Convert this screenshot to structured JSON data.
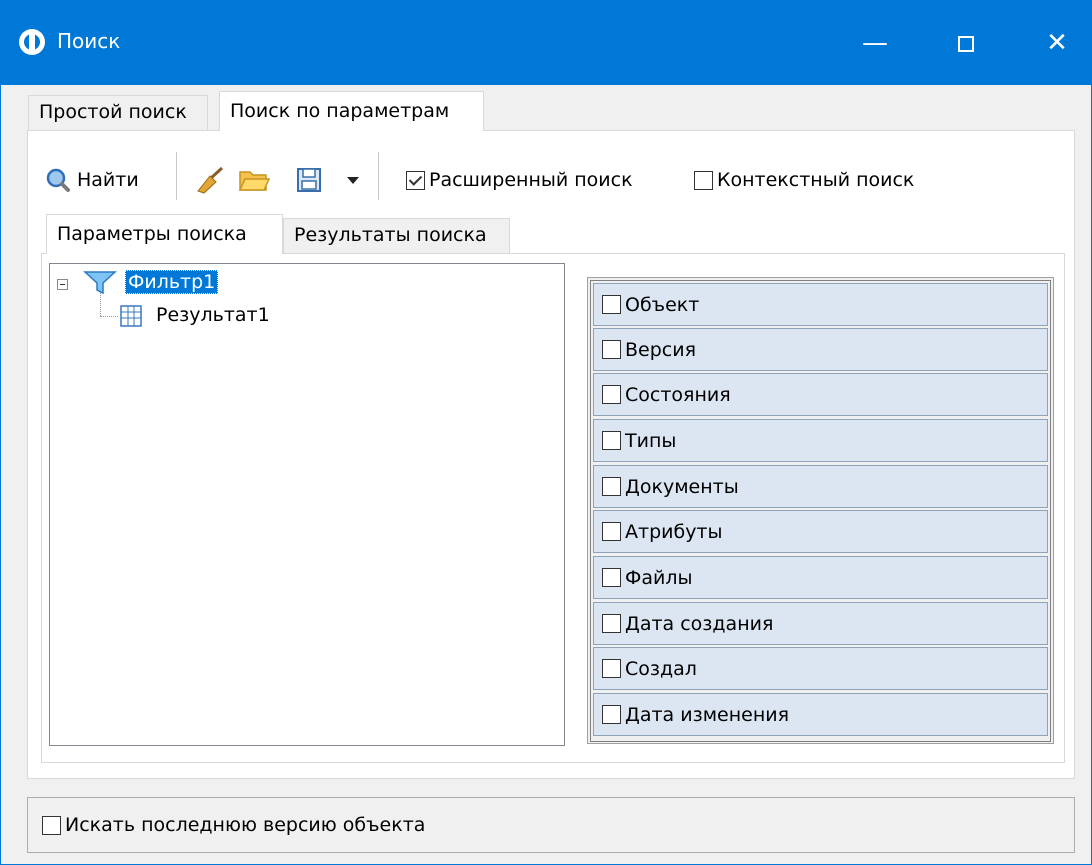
{
  "window": {
    "title": "Поиск",
    "minimize": "—",
    "close": "✕"
  },
  "tabs": [
    "Простой поиск",
    "Поиск по параметрам"
  ],
  "toolbar": {
    "find_label": "Найти",
    "extended_search_label": "Расширенный поиск",
    "extended_search_checked": true,
    "context_search_label": "Контекстный поиск",
    "context_search_checked": false,
    "icons": [
      "search-icon",
      "broom-icon",
      "folder-icon",
      "save-icon",
      "dropdown-arrow-icon"
    ]
  },
  "subtabs": [
    "Параметры поиска",
    "Результаты поиска"
  ],
  "tree": {
    "root": {
      "label": "Фильтр1",
      "icon": "filter-icon",
      "selected": true,
      "expanded": true
    },
    "child": {
      "label": "Результат1",
      "icon": "table-icon"
    }
  },
  "params": [
    "Объект",
    "Версия",
    "Состояния",
    "Типы",
    "Документы",
    "Атрибуты",
    "Файлы",
    "Дата создания",
    "Создал",
    "Дата изменения"
  ],
  "bottom": {
    "last_version_label": "Искать последнюю версию объекта",
    "checked": false
  },
  "colors": {
    "titlebar": "#0078d7",
    "selection": "#0078d7",
    "param_row": "#dce6f2"
  }
}
